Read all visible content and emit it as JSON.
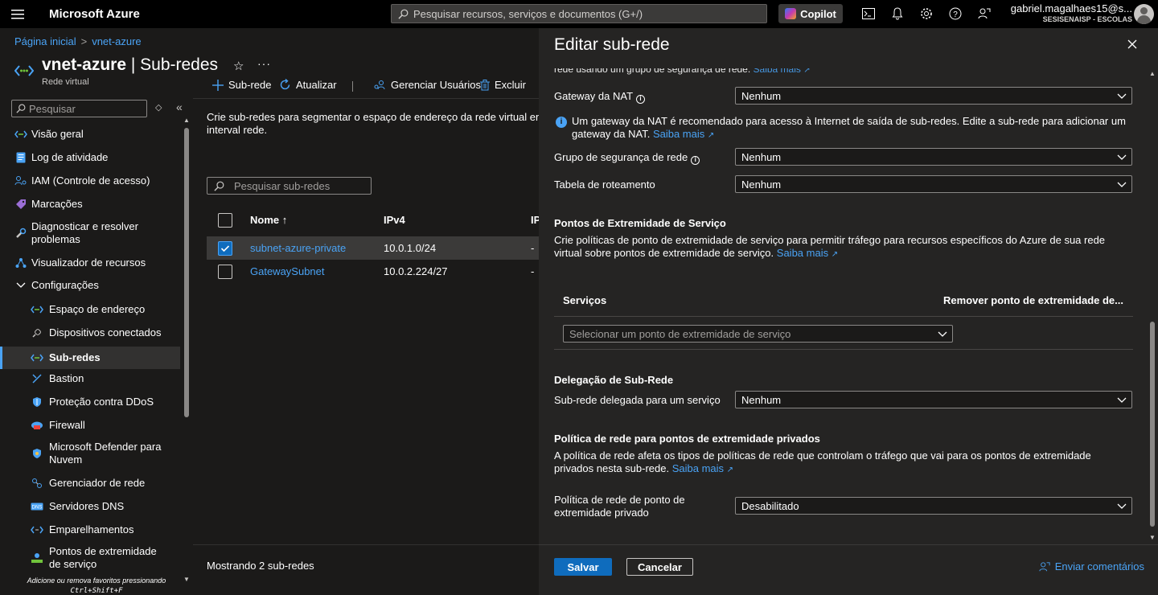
{
  "topbar": {
    "brand": "Microsoft Azure",
    "search_placeholder": "Pesquisar recursos, serviços e documentos (G+/)",
    "copilot_label": "Copilot",
    "account_name": "gabriel.magalhaes15@s...",
    "account_tenant": "SESISENAISP - ESCOLAS"
  },
  "breadcrumb": {
    "home": "Página inicial",
    "resource": "vnet-azure"
  },
  "header": {
    "resource_name": "vnet-azure",
    "separator": " | ",
    "page_name": "Sub-redes",
    "resource_type": "Rede virtual"
  },
  "sidebar": {
    "search_placeholder": "Pesquisar",
    "items": [
      {
        "label": "Visão geral",
        "icon": "vnet-icon"
      },
      {
        "label": "Log de atividade",
        "icon": "activity-log-icon"
      },
      {
        "label": "IAM (Controle de acesso)",
        "icon": "iam-icon"
      },
      {
        "label": "Marcações",
        "icon": "tag-icon"
      },
      {
        "label": "Diagnosticar e resolver problemas",
        "icon": "wrench-icon"
      },
      {
        "label": "Visualizador de recursos",
        "icon": "resource-visualizer-icon"
      },
      {
        "label": "Configurações",
        "icon": "chevron-down-icon"
      },
      {
        "label": "Espaço de endereço",
        "icon": "address-space-icon"
      },
      {
        "label": "Dispositivos conectados",
        "icon": "plug-icon"
      },
      {
        "label": "Sub-redes",
        "icon": "subnet-icon"
      },
      {
        "label": "Bastion",
        "icon": "bastion-icon"
      },
      {
        "label": "Proteção contra DDoS",
        "icon": "shield-icon"
      },
      {
        "label": "Firewall",
        "icon": "firewall-icon"
      },
      {
        "label": "Microsoft Defender para Nuvem",
        "icon": "defender-icon"
      },
      {
        "label": "Gerenciador de rede",
        "icon": "network-manager-icon"
      },
      {
        "label": "Servidores DNS",
        "icon": "dns-icon"
      },
      {
        "label": "Emparelhamentos",
        "icon": "peering-icon"
      },
      {
        "label": "Pontos de extremidade de serviço",
        "icon": "service-endpoint-icon"
      }
    ],
    "favorites_hint": "Adicione ou remova favoritos pressionando",
    "favorites_shortcut": "Ctrl+Shift+F"
  },
  "toolbar": {
    "add_subnet": "Sub-rede",
    "refresh": "Atualizar",
    "manage_users": "Gerenciar Usuários",
    "delete": "Excluir"
  },
  "subnets": {
    "description": "Crie sub-redes para segmentar o espaço de endereço da rede virtual em interval rede.",
    "search_placeholder": "Pesquisar sub-redes",
    "columns": {
      "name": "Nome ↑",
      "ipv4": "IPv4",
      "ipv6": "IP"
    },
    "rows": [
      {
        "name": "subnet-azure-private",
        "ipv4": "10.0.1.0/24",
        "ipv6": "-",
        "checked": true
      },
      {
        "name": "GatewaySubnet",
        "ipv4": "10.0.2.224/27",
        "ipv6": "-",
        "checked": false
      }
    ],
    "footer": "Mostrando 2 sub-redes"
  },
  "edit_pane": {
    "title": "Editar sub-rede",
    "cut_text": "rede usando um grupo de segurança de rede.",
    "learn_more": "Saiba mais",
    "nat_gateway_label": "Gateway da NAT",
    "nat_gateway_value": "Nenhum",
    "nat_info": "Um gateway da NAT é recomendado para acesso à Internet de saída de sub-redes. Edite a sub-rede para adicionar um gateway da NAT.",
    "nsg_label": "Grupo de segurança de rede",
    "nsg_value": "Nenhum",
    "route_table_label": "Tabela de roteamento",
    "route_table_value": "Nenhum",
    "service_endpoints_heading": "Pontos de Extremidade de Serviço",
    "service_endpoints_desc": "Crie políticas de ponto de extremidade de serviço para permitir tráfego para recursos específicos do Azure de sua rede virtual sobre pontos de extremidade de serviço.",
    "services_col": "Serviços",
    "remove_col": "Remover ponto de extremidade de...",
    "service_select_placeholder": "Selecionar um ponto de extremidade de serviço",
    "delegation_heading": "Delegação de Sub-Rede",
    "delegation_label": "Sub-rede delegada para um serviço",
    "delegation_value": "Nenhum",
    "private_policy_heading": "Política de rede para pontos de extremidade privados",
    "private_policy_desc": "A política de rede afeta os tipos de políticas de rede que controlam o tráfego que vai para os pontos de extremidade privados nesta sub-rede.",
    "private_policy_label": "Política de rede de ponto de extremidade privado",
    "private_policy_value": "Desabilitado",
    "save": "Salvar",
    "cancel": "Cancelar",
    "feedback": "Enviar comentários"
  },
  "colors": {
    "accent": "#4aa3f5",
    "primary_button": "#0f6cbd",
    "background": "#1b1a19",
    "pane": "#252423"
  }
}
